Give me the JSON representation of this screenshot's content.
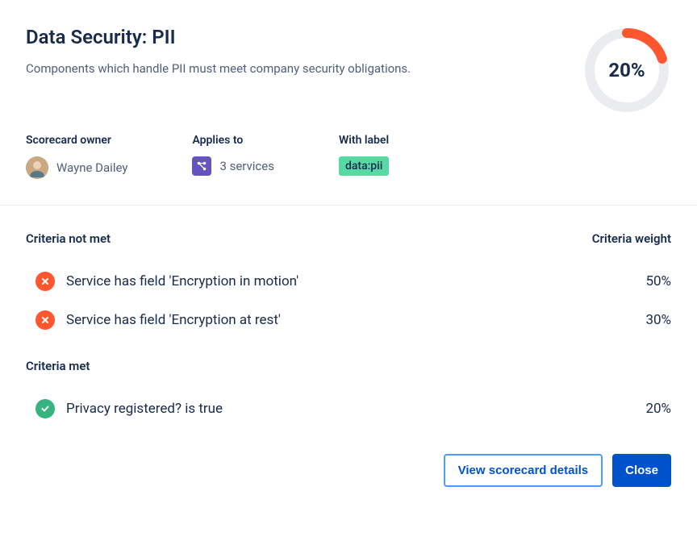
{
  "header": {
    "title": "Data Security: PII",
    "description": "Components which handle PII must meet company security obligations.",
    "progress_percent": "20%",
    "progress_value": 20
  },
  "meta": {
    "owner_label": "Scorecard owner",
    "owner_name": "Wayne Dailey",
    "applies_to_label": "Applies to",
    "applies_to_value": "3 services",
    "with_label_label": "With label",
    "label_tag": "data:pii"
  },
  "criteria": {
    "not_met_title": "Criteria not met",
    "met_title": "Criteria met",
    "weight_header": "Criteria weight",
    "not_met": [
      {
        "text": "Service has field 'Encryption in motion'",
        "weight": "50%"
      },
      {
        "text": "Service has field 'Encryption at rest'",
        "weight": "30%"
      }
    ],
    "met": [
      {
        "text": "Privacy registered? is true",
        "weight": "20%"
      }
    ]
  },
  "actions": {
    "view_details": "View scorecard details",
    "close": "Close"
  }
}
